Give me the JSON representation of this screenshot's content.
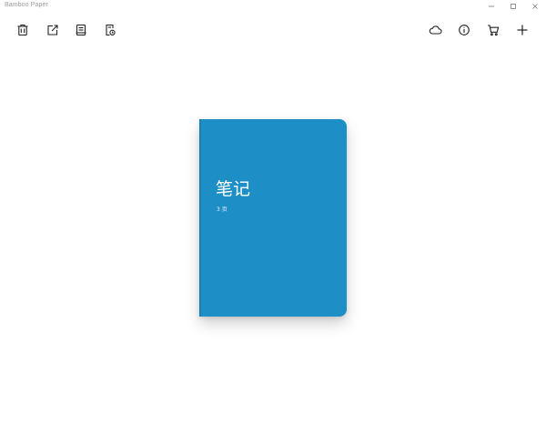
{
  "window": {
    "title": "Bamboo Paper"
  },
  "toolbar": {
    "left_icons": [
      "trash-icon",
      "export-icon",
      "notebook-info-icon",
      "page-settings-icon"
    ],
    "right_icons": [
      "cloud-icon",
      "info-icon",
      "cart-icon",
      "add-icon"
    ]
  },
  "notebook": {
    "title": "笔记",
    "pages": "3 页",
    "cover_color": "#1e8fc6"
  }
}
